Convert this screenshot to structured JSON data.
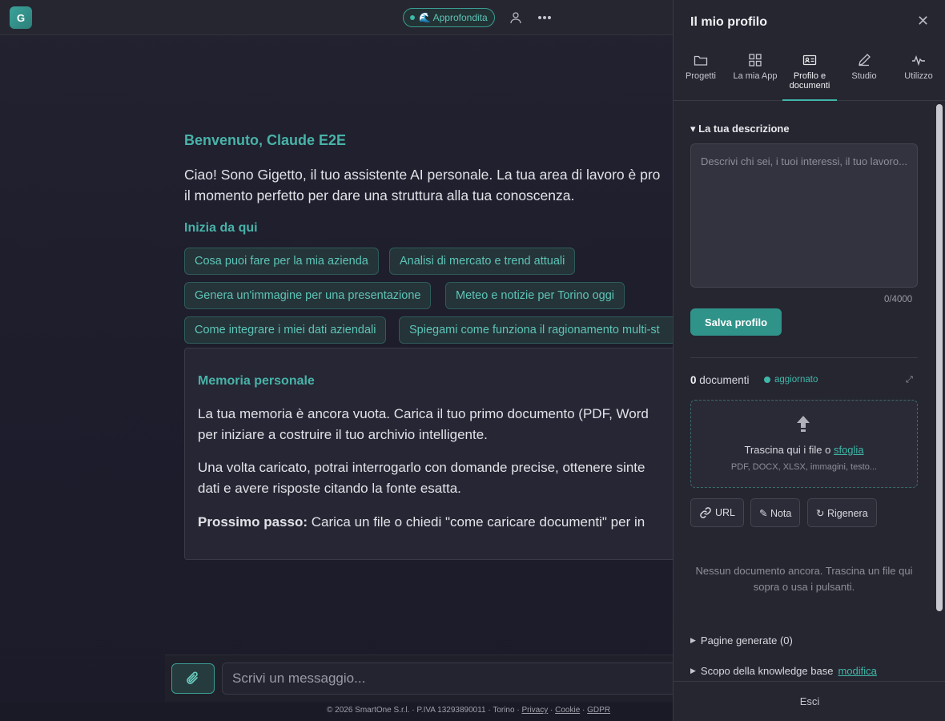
{
  "topbar": {
    "logo_letter": "G",
    "mode_label": "🌊 Approfondita"
  },
  "main": {
    "welcome": "Benvenuto, Claude E2E",
    "intro_line1": "Ciao! Sono Gigetto, il tuo assistente AI personale. La tua area di lavoro è pro",
    "intro_line2": "il momento perfetto per dare una struttura alla tua conoscenza.",
    "start_title": "Inizia da qui",
    "suggestions": [
      "Cosa puoi fare per la mia azienda",
      "Analisi di mercato e trend attuali",
      "Genera un'immagine per una presentazione",
      "Meteo e notizie per Torino oggi",
      "Come integrare i miei dati aziendali",
      "Spiegami come funziona il ragionamento multi-st"
    ]
  },
  "memory": {
    "title": "Memoria personale",
    "p1_line1": "La tua memoria è ancora vuota. Carica il tuo primo documento (PDF, Word",
    "p1_line2": "per iniziare a costruire il tuo archivio intelligente.",
    "p2_line1": "Una volta caricato, potrai interrogarlo con domande precise, ottenere sinte",
    "p2_line2": "dati e avere risposte citando la fonte esatta.",
    "next_label": "Prossimo passo:",
    "next_text": " Carica un file o chiedi \"come caricare documenti\" per in"
  },
  "composer": {
    "placeholder": "Scrivi un messaggio..."
  },
  "footer": {
    "text": "© 2026 SmartOne S.r.l. · P.IVA 13293890011 · Torino · ",
    "privacy": "Privacy",
    "cookie": "Cookie",
    "gdpr": "GDPR",
    "sep": " · "
  },
  "panel": {
    "title": "Il mio profilo",
    "tabs": [
      {
        "label": "Progetti",
        "icon": "folder-icon"
      },
      {
        "label": "La mia App",
        "icon": "grid-icon"
      },
      {
        "label": "Profilo e documenti",
        "icon": "id-card-icon"
      },
      {
        "label": "Studio",
        "icon": "pen-icon"
      },
      {
        "label": "Utilizzo",
        "icon": "activity-icon"
      }
    ],
    "active_tab": "Profilo e documenti",
    "description_heading": "La tua descrizione",
    "description_placeholder": "Descrivi chi sei, i tuoi interessi, il tuo lavoro...",
    "description_counter": "0/4000",
    "save_label": "Salva profilo",
    "docs_count": "0",
    "docs_label": " documenti",
    "status_label": "aggiornato",
    "drop_text": "Trascina qui i file o ",
    "drop_link": "sfoglia",
    "drop_hint": "PDF, DOCX, XLSX, immagini, testo...",
    "buttons": {
      "url": "URL",
      "note": "✎ Nota",
      "regenerate": "↻ Rigenera"
    },
    "empty_message": "Nessun documento ancora. Trascina un file qui sopra o usa i pulsanti.",
    "generated_pages": "Pagine generate (0)",
    "kb_scope": "Scopo della knowledge base ",
    "kb_scope_link": "modifica",
    "logout": "Esci"
  },
  "colors": {
    "accent": "#3fb8a8",
    "background": "#1e1e2c",
    "panel": "#262631"
  }
}
